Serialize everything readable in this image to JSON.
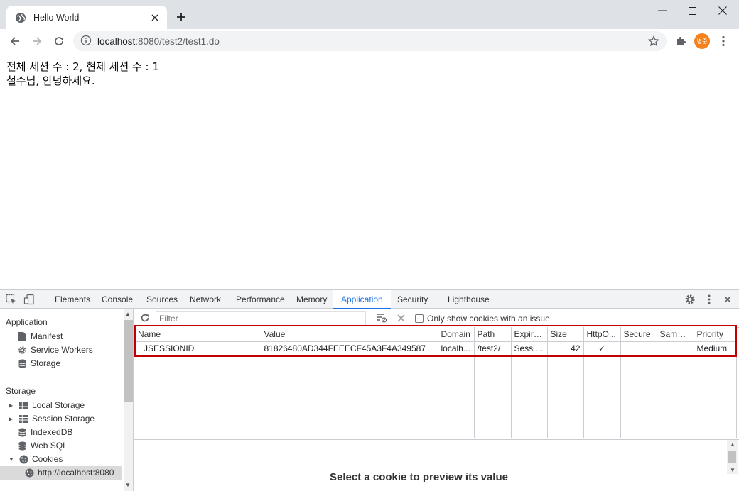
{
  "browser": {
    "tab_title": "Hello World",
    "url_host": "localhost",
    "url_rest": ":8080/test2/test1.do",
    "profile_initials": "병준"
  },
  "page": {
    "line1": "전체 세션 수 : 2, 현제 세션 수 : 1",
    "line2": "철수님, 안녕하세요."
  },
  "devtools": {
    "tabs": [
      "Elements",
      "Console",
      "Sources",
      "Network",
      "Performance",
      "Memory",
      "Application",
      "Security",
      "Lighthouse"
    ],
    "active_tab": "Application",
    "sidebar": {
      "application_header": "Application",
      "application_items": [
        "Manifest",
        "Service Workers",
        "Storage"
      ],
      "storage_header": "Storage",
      "storage_items": [
        "Local Storage",
        "Session Storage",
        "IndexedDB",
        "Web SQL",
        "Cookies"
      ],
      "cookie_origin": "http://localhost:8080"
    },
    "toolbar": {
      "filter_placeholder": "Filter",
      "only_issues_label": "Only show cookies with an issue"
    },
    "table": {
      "headers": [
        "Name",
        "Value",
        "Domain",
        "Path",
        "Expires...",
        "Size",
        "HttpO...",
        "Secure",
        "SameS...",
        "Priority"
      ],
      "rows": [
        {
          "name": "JSESSIONID",
          "value": "81826480AD344FEEECF45A3F4A349587",
          "domain": "localh...",
          "path": "/test2/",
          "expires": "Session",
          "size": "42",
          "httponly": "✓",
          "secure": "",
          "samesite": "",
          "priority": "Medium"
        }
      ]
    },
    "bottom_pane_text": "Select a cookie to preview its value"
  },
  "colors": {
    "accent": "#1a73e8",
    "highlight": "#c00000",
    "avatar": "#f5821f"
  }
}
